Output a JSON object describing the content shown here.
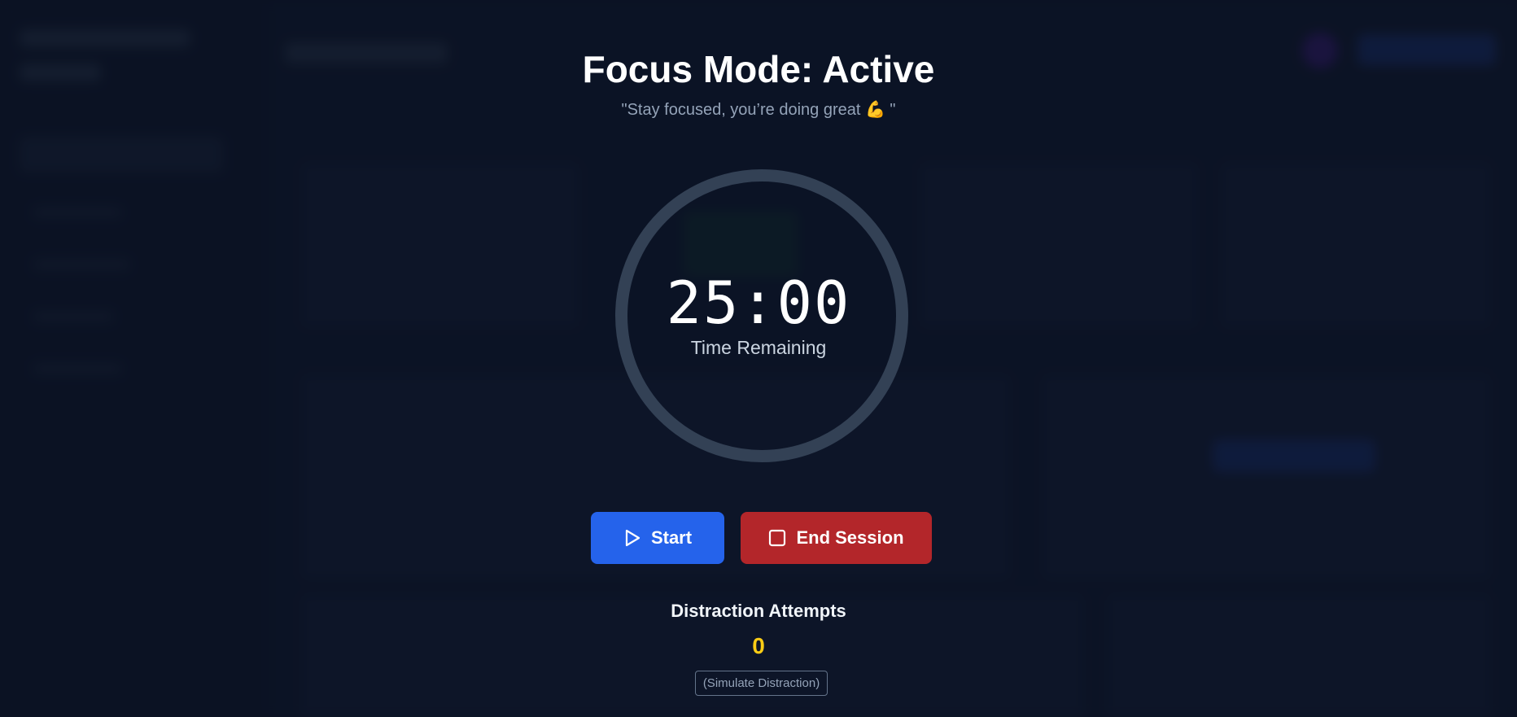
{
  "focus": {
    "title": "Focus Mode: Active",
    "quote": "\"Stay focused, you’re doing great 💪 \"",
    "timer": {
      "value": "25:00",
      "label": "Time Remaining"
    },
    "buttons": {
      "start_label": "Start",
      "start_icon": "play-icon",
      "end_label": "End Session",
      "end_icon": "stop-icon"
    },
    "distraction": {
      "title": "Distraction Attempts",
      "count": "0",
      "simulate_label": "(Simulate Distraction)"
    }
  },
  "colors": {
    "background": "#0e1526",
    "start_button": "#2563eb",
    "end_button": "#b3262a",
    "count": "#facc15",
    "ring": "#334155"
  }
}
